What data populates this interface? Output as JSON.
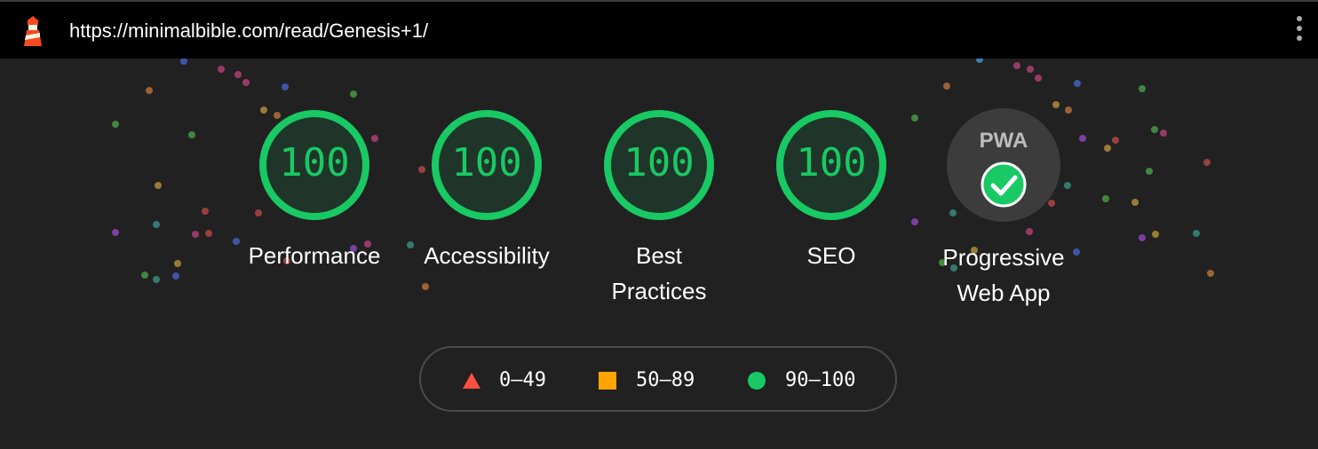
{
  "browser": {
    "url": "https://minimalbible.com/read/Genesis+1/",
    "logo_icon": "lighthouse-icon",
    "menu_icon": "more-vert-icon"
  },
  "gauges": [
    {
      "score": "100",
      "label": "Performance",
      "color": "#18c964"
    },
    {
      "score": "100",
      "label": "Accessibility",
      "color": "#18c964"
    },
    {
      "score": "100",
      "label": "Best Practices",
      "label_lines": [
        "Best",
        "Practices"
      ],
      "color": "#18c964"
    },
    {
      "score": "100",
      "label": "SEO",
      "color": "#18c964"
    }
  ],
  "pwa": {
    "badge_text": "PWA",
    "label_lines": [
      "Progressive",
      "Web App"
    ],
    "status_icon": "check-circle-icon",
    "check_color": "#18c964"
  },
  "legend": [
    {
      "range": "0–49",
      "shape": "triangle",
      "color": "#ff4e42"
    },
    {
      "range": "50–89",
      "shape": "square",
      "color": "#ffa400"
    },
    {
      "range": "90–100",
      "shape": "circle",
      "color": "#18c964"
    }
  ],
  "colors": {
    "background": "#212121",
    "topbar": "#000000",
    "pass": "#18c964",
    "average": "#ffa400",
    "fail": "#ff4e42"
  }
}
